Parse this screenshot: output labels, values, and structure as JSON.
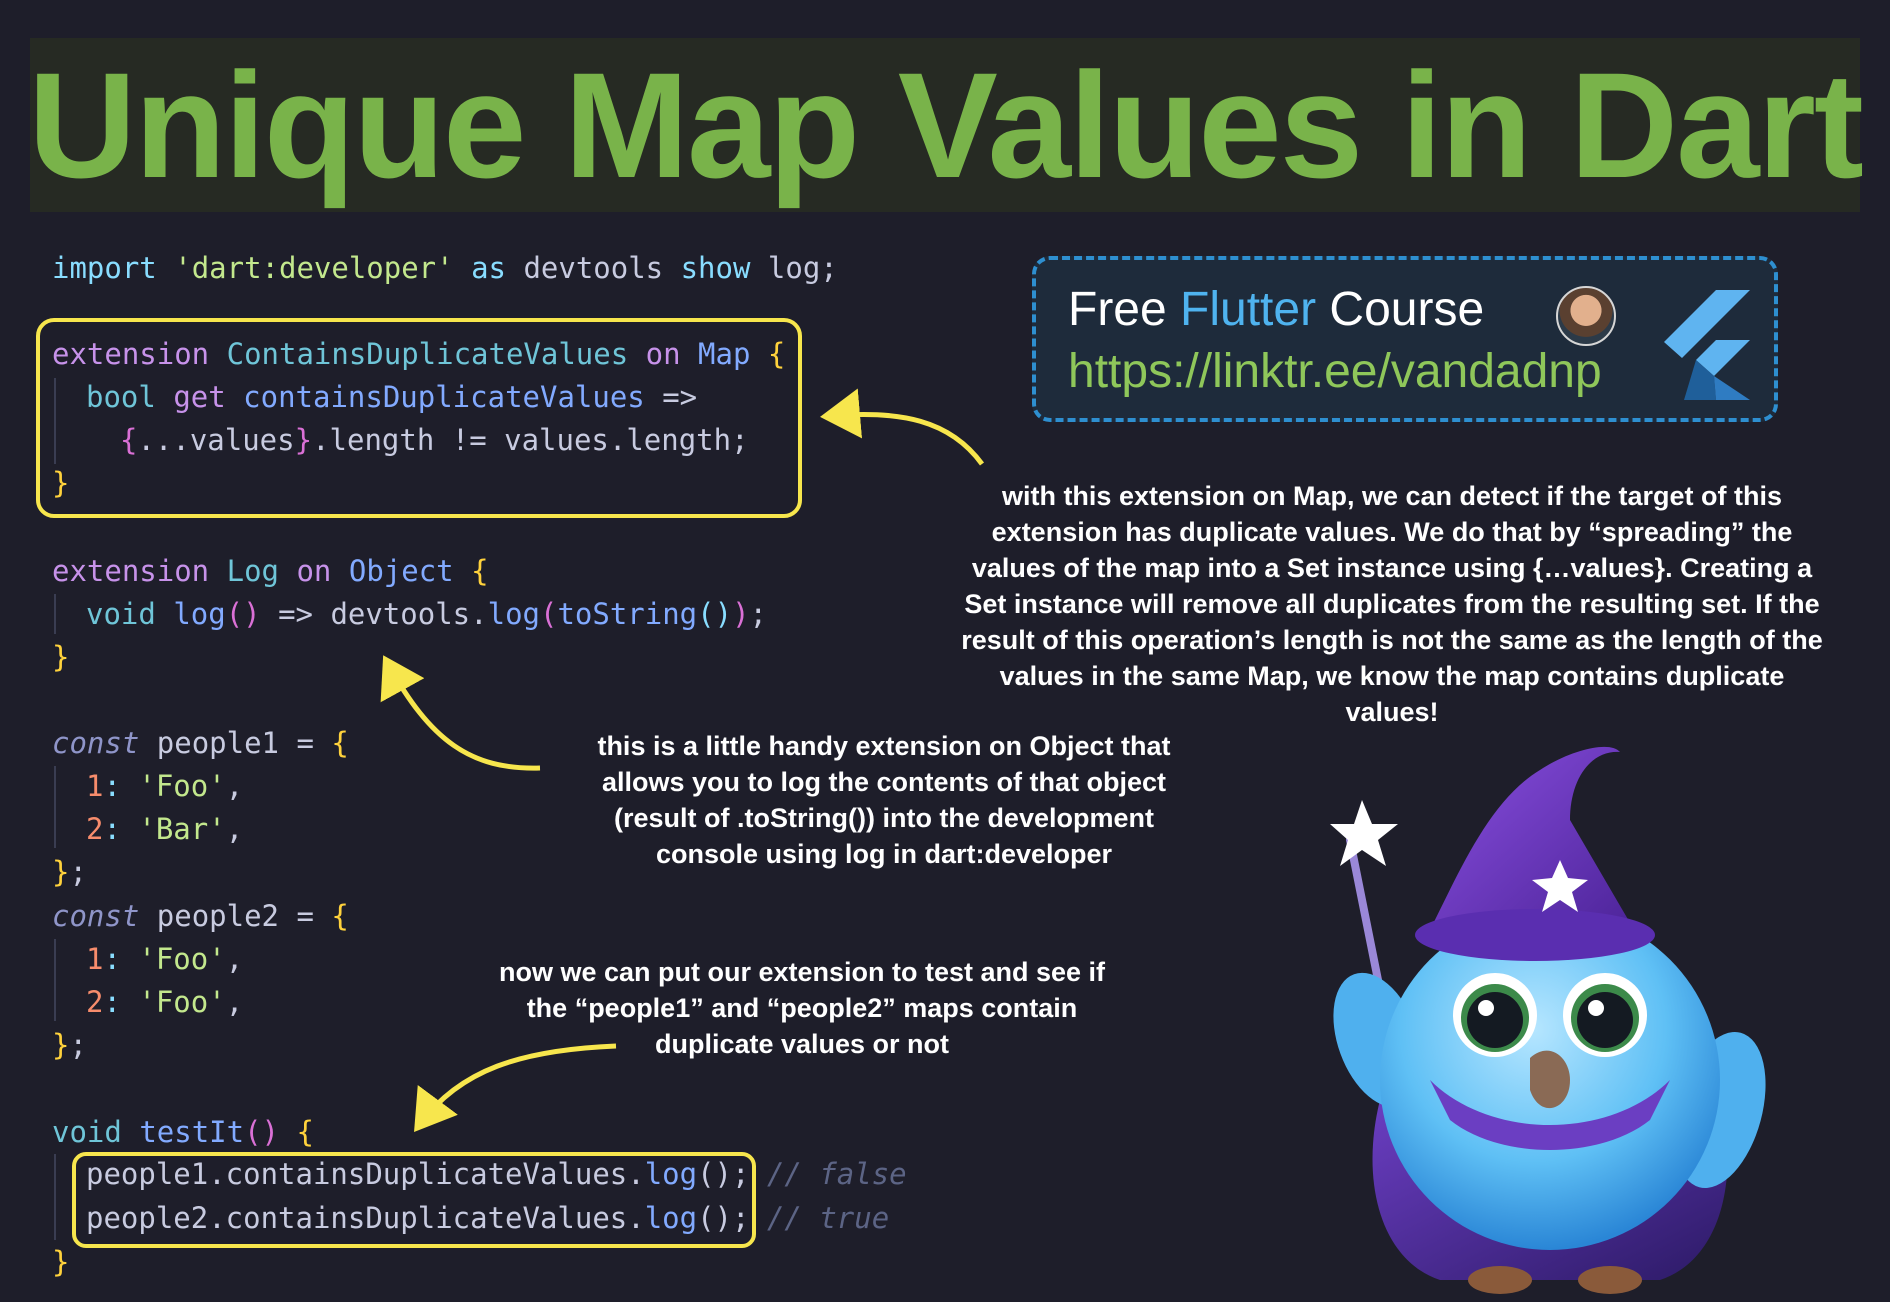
{
  "title": "Unique Map Values in Dart",
  "course": {
    "line1_prefix": "Free ",
    "line1_accent": "Flutter",
    "line1_suffix": " Course",
    "url": "https://linktr.ee/vandadnp"
  },
  "code": {
    "import": [
      "import",
      " ",
      "'dart:developer'",
      " ",
      "as",
      " devtools ",
      "show",
      " log;"
    ],
    "ext1_l1": [
      "extension",
      " ",
      "ContainsDuplicateValues",
      " ",
      "on",
      " ",
      "Map",
      " ",
      "{"
    ],
    "ext1_l2": [
      "bool",
      " ",
      "get",
      " ",
      "containsDuplicateValues",
      " =>"
    ],
    "ext1_l3": [
      "{",
      "...values",
      "}",
      ".length != values.length;"
    ],
    "ext1_l4": "}",
    "ext2_l1": [
      "extension",
      " ",
      "Log",
      " ",
      "on",
      " ",
      "Object",
      " ",
      "{"
    ],
    "ext2_l2": [
      "void",
      " ",
      "log",
      "()",
      " => devtools.",
      "log",
      "(",
      "toString",
      "()",
      ")",
      ";"
    ],
    "ext2_l3": "}",
    "p1_l1": [
      "const",
      " people1 = ",
      "{"
    ],
    "p1_l2": [
      "1",
      ": ",
      "'Foo'",
      ","
    ],
    "p1_l3": [
      "2",
      ": ",
      "'Bar'",
      ","
    ],
    "p1_l4": [
      "}",
      ";"
    ],
    "p2_l1": [
      "const",
      " people2 = ",
      "{"
    ],
    "p2_l2": [
      "1",
      ": ",
      "'Foo'",
      ","
    ],
    "p2_l3": [
      "2",
      ": ",
      "'Foo'",
      ","
    ],
    "p2_l4": [
      "}",
      ";"
    ],
    "test_l1": [
      "void",
      " ",
      "testIt",
      "()",
      " ",
      "{"
    ],
    "test_l2": [
      "people1.containsDuplicateValues.",
      "log",
      "();",
      " // false"
    ],
    "test_l3": [
      "people2.containsDuplicateValues.",
      "log",
      "();",
      " // true"
    ],
    "test_l4": "}"
  },
  "notes": {
    "map_extension": [
      "with this extension on Map, we can detect if the target of this",
      "extension has duplicate values. We do that by “spreading” the",
      "values of the map into a Set instance using {…values}. Creating a",
      "Set instance will remove all duplicates from the resulting set. If the",
      "result of this operation’s length is not the same as the length of the",
      "values in the same Map, we know the map contains duplicate",
      "values!"
    ],
    "log_extension": [
      "this is a little handy extension on Object that",
      "allows you to log the contents of that object",
      "(result of .toString()) into the development",
      "console using log in dart:developer"
    ],
    "test": [
      "now we can put our extension to test and see if",
      "the “people1” and “people2” maps contain",
      "duplicate values or not"
    ]
  },
  "colors": {
    "title_green": "#79b34a",
    "highlight_yellow": "#f7e64d",
    "course_border": "#2e8fd0",
    "background": "#1e1e2a"
  }
}
